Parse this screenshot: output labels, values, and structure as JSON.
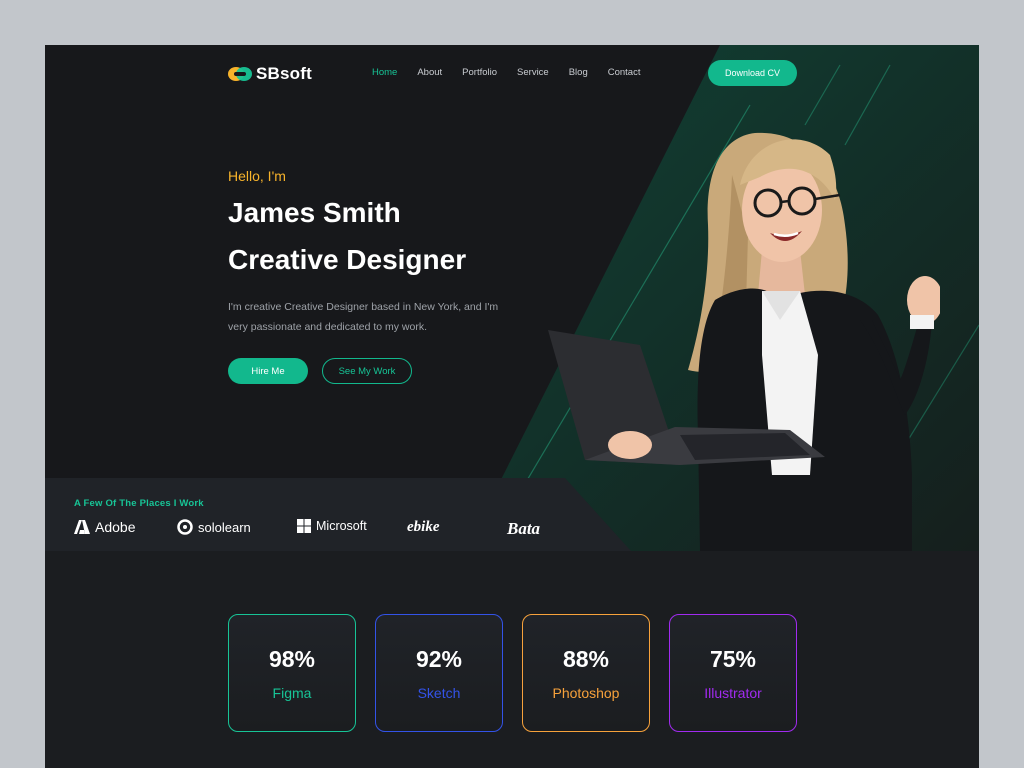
{
  "brand": {
    "name": "SBsoft"
  },
  "nav": {
    "items": [
      {
        "label": "Home",
        "active": true
      },
      {
        "label": "About"
      },
      {
        "label": "Portfolio"
      },
      {
        "label": "Service"
      },
      {
        "label": "Blog"
      },
      {
        "label": "Contact"
      }
    ],
    "download_label": "Download CV"
  },
  "hero": {
    "greeting": "Hello, I'm",
    "name": "James Smith",
    "role": "Creative Designer",
    "description": "I'm creative Creative Designer based in New York, and I'm very passionate and dedicated to my work.",
    "hire_label": "Hire Me",
    "work_label": "See My Work"
  },
  "clients": {
    "title": "A Few Of The Places I Work",
    "logos": [
      "Adobe",
      "sololearn",
      "Microsoft",
      "ebike",
      "Bata"
    ]
  },
  "skills": [
    {
      "value": "98%",
      "name": "Figma",
      "color": "#17c496"
    },
    {
      "value": "92%",
      "name": "Sketch",
      "color": "#3353e8"
    },
    {
      "value": "88%",
      "name": "Photoshop",
      "color": "#f7a23b"
    },
    {
      "value": "75%",
      "name": "Illustrator",
      "color": "#a12bf0"
    }
  ],
  "colors": {
    "accent": "#12b88d",
    "accent_light": "#17c496",
    "greeting": "#f7b32b",
    "background": "#17181b"
  }
}
